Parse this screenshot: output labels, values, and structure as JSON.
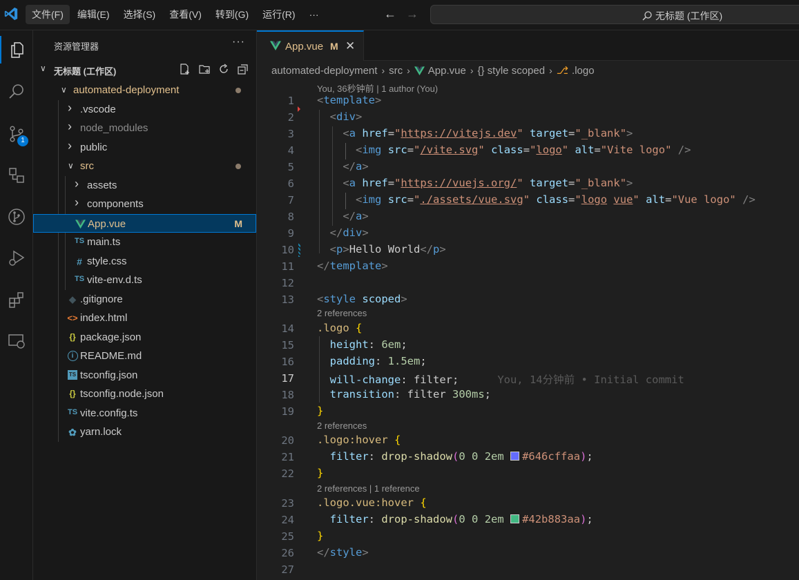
{
  "menu": [
    "文件(F)",
    "编辑(E)",
    "选择(S)",
    "查看(V)",
    "转到(G)",
    "运行(R)",
    "···"
  ],
  "search": {
    "label": "无标题 (工作区)"
  },
  "activity": {
    "source_control_badge": "1"
  },
  "sidebar": {
    "title": "资源管理器",
    "more": "···",
    "workspace": "无标题 (工作区)",
    "tree": [
      {
        "label": "automated-deployment",
        "kind": "folder-open",
        "depth": 0,
        "style": "mod",
        "dot": true
      },
      {
        "label": ".vscode",
        "kind": "folder",
        "depth": 1
      },
      {
        "label": "node_modules",
        "kind": "folder",
        "depth": 1,
        "style": "dim"
      },
      {
        "label": "public",
        "kind": "folder",
        "depth": 1
      },
      {
        "label": "src",
        "kind": "folder-open",
        "depth": 1,
        "style": "mod",
        "dot": true
      },
      {
        "label": "assets",
        "kind": "folder",
        "depth": 2
      },
      {
        "label": "components",
        "kind": "folder",
        "depth": 2
      },
      {
        "label": "App.vue",
        "kind": "vue",
        "depth": 2,
        "style": "mod",
        "badge": "M",
        "selected": true
      },
      {
        "label": "main.ts",
        "kind": "ts",
        "depth": 2
      },
      {
        "label": "style.css",
        "kind": "css",
        "depth": 2
      },
      {
        "label": "vite-env.d.ts",
        "kind": "ts",
        "depth": 2
      },
      {
        "label": ".gitignore",
        "kind": "git",
        "depth": 1
      },
      {
        "label": "index.html",
        "kind": "html",
        "depth": 1
      },
      {
        "label": "package.json",
        "kind": "json",
        "depth": 1
      },
      {
        "label": "README.md",
        "kind": "info",
        "depth": 1
      },
      {
        "label": "tsconfig.json",
        "kind": "tsconfig",
        "depth": 1
      },
      {
        "label": "tsconfig.node.json",
        "kind": "json",
        "depth": 1
      },
      {
        "label": "vite.config.ts",
        "kind": "ts",
        "depth": 1
      },
      {
        "label": "yarn.lock",
        "kind": "yarn",
        "depth": 1
      }
    ]
  },
  "tab": {
    "label": "App.vue",
    "status": "M",
    "close": "✕"
  },
  "breadcrumb": [
    "automated-deployment",
    "src",
    "App.vue",
    "{} style scoped",
    ".logo"
  ],
  "codelens": {
    "author": "You, 36秒钟前 | 1 author (You)",
    "refs2": "2 references",
    "refs2b": "2 references",
    "refs2c": "2 references | 1 reference"
  },
  "blame": "You, 14分钟前 • Initial commit",
  "current_line": 17,
  "line_numbers": [
    "1",
    "2",
    "3",
    "4",
    "5",
    "6",
    "7",
    "8",
    "9",
    "10",
    "11",
    "12",
    "13",
    "14",
    "15",
    "16",
    "17",
    "18",
    "19",
    "20",
    "21",
    "22",
    "23",
    "24",
    "25",
    "26",
    "27"
  ],
  "colors": {
    "accent": "#0078d4",
    "modified": "#e2c08d",
    "swatch1": "#646cff",
    "swatch2": "#42b883"
  }
}
